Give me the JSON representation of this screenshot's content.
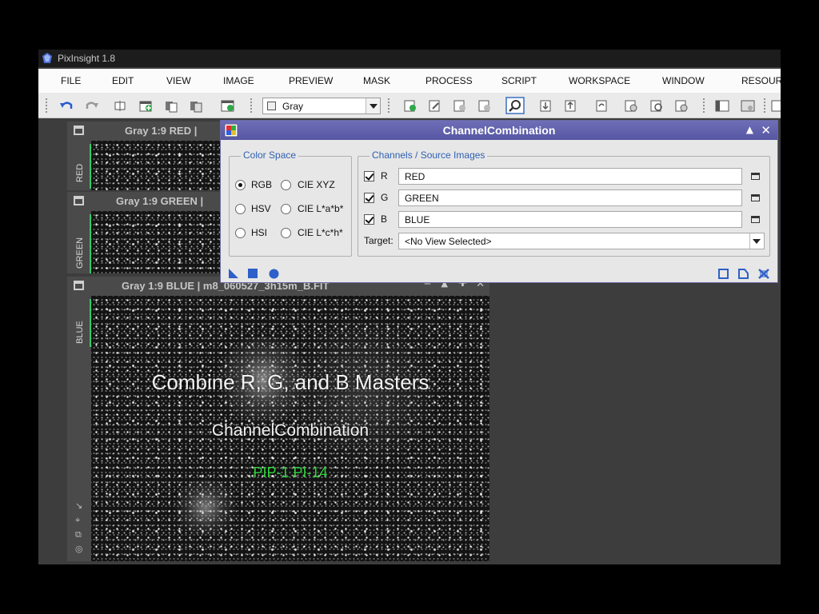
{
  "app": {
    "title": "PixInsight 1.8"
  },
  "menu": [
    "FILE",
    "EDIT",
    "VIEW",
    "IMAGE",
    "PREVIEW",
    "MASK",
    "PROCESS",
    "SCRIPT",
    "WORKSPACE",
    "WINDOW",
    "RESOUR"
  ],
  "toolbar": {
    "view_select": "Gray"
  },
  "windows": {
    "red": {
      "title": "Gray 1:9 RED |",
      "tab": "RED"
    },
    "green": {
      "title": "Gray 1:9 GREEN |",
      "tab": "GREEN"
    },
    "blue": {
      "title": "Gray 1:9 BLUE | m8_060527_3h15m_B.FIT",
      "tab": "BLUE"
    }
  },
  "dialog": {
    "title": "ChannelCombination",
    "color_space": {
      "label": "Color Space",
      "options": [
        "RGB",
        "CIE XYZ",
        "HSV",
        "CIE L*a*b*",
        "HSI",
        "CIE L*c*h*"
      ],
      "selected": "RGB"
    },
    "channels": {
      "label": "Channels / Source Images",
      "rows": [
        {
          "channel": "R",
          "checked": true,
          "image": "RED"
        },
        {
          "channel": "G",
          "checked": true,
          "image": "GREEN"
        },
        {
          "channel": "B",
          "checked": true,
          "image": "BLUE"
        }
      ],
      "target_label": "Target:",
      "target_value": "<No View Selected>"
    }
  },
  "overlay": {
    "headline": "Combine R, G, and B Masters",
    "subtitle": "ChannelCombination",
    "code": "PIP-1 PI-14",
    "code_color": "#2fd23a"
  }
}
